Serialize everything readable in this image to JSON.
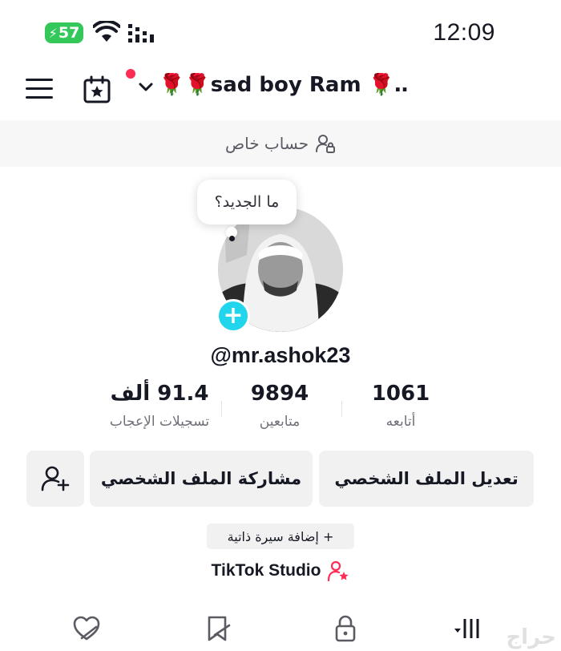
{
  "status_bar": {
    "battery": "57",
    "time": "12:09"
  },
  "header": {
    "account_name": "🌹🌹sad boy Ram 🌹…",
    "has_notification": true
  },
  "private_banner": {
    "label": "حساب خاص"
  },
  "profile": {
    "note_bubble": "ما الجديد؟",
    "add_symbol": "+",
    "username": "@mr.ashok23"
  },
  "stats": [
    {
      "value": "1061",
      "label": "أتابعه"
    },
    {
      "value": "9894",
      "label": "متابعين"
    },
    {
      "value": "91.4 ألف",
      "label": "تسجيلات الإعجاب"
    }
  ],
  "actions": {
    "edit_profile": "تعديل الملف الشخصي",
    "share_profile": "مشاركة الملف الشخصي",
    "add_bio": "+ إضافة سيرة ذاتية",
    "studio": "TikTok Studio"
  },
  "watermark": "حراج",
  "colors": {
    "accent_pink": "#fe2c55",
    "accent_cyan": "#20d5ec",
    "battery_green": "#34c759",
    "button_bg": "#f1f1f2"
  },
  "icons": [
    "menu-icon",
    "calendar-star-icon",
    "chevron-down-icon",
    "private-account-icon",
    "add-friend-icon",
    "studio-person-star-icon",
    "liked-heart-icon",
    "favorites-icon",
    "lock-icon",
    "videos-grid-icon"
  ]
}
